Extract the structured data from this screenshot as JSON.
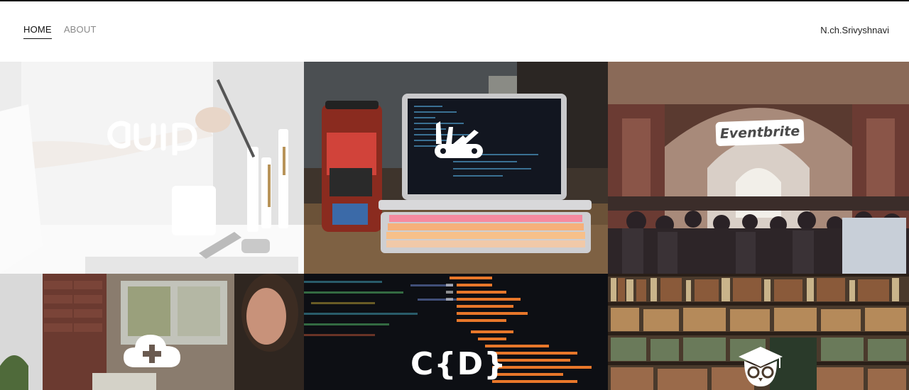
{
  "nav": {
    "items": [
      {
        "label": "HOME",
        "active": true
      },
      {
        "label": "ABOUT",
        "active": false
      }
    ]
  },
  "brand": {
    "name": "N.ch.Srivyshnavi"
  },
  "projects": [
    {
      "logo_text": "quip",
      "icon": "quip-logo"
    },
    {
      "logo_text": "",
      "icon": "swiss-knife-icon"
    },
    {
      "logo_text": "Eventbrite",
      "icon": "eventbrite-logo"
    },
    {
      "logo_text": "",
      "icon": "cloud-plus-icon"
    },
    {
      "logo_text": "C{D}",
      "icon": "codedamn-logo"
    },
    {
      "logo_text": "",
      "icon": "owl-graduate-icon"
    }
  ],
  "colors": {
    "nav_active": "#111111",
    "nav_inactive": "#8a8a8a",
    "page_bg": "#ffffff"
  }
}
